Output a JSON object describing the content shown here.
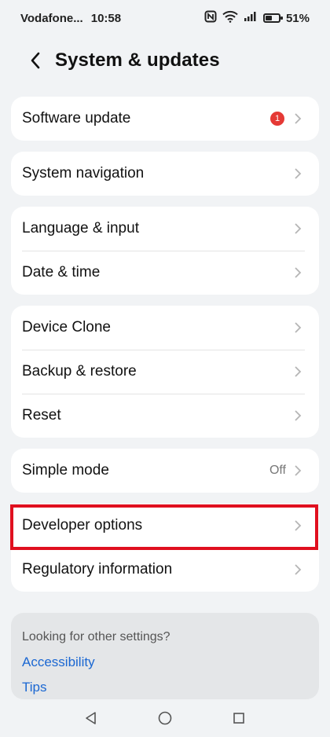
{
  "status_bar": {
    "carrier": "Vodafone...",
    "time": "10:58",
    "battery": "51%",
    "battery_level_pct": 51,
    "icons": [
      "nfc-icon",
      "wifi-icon",
      "signal-icon",
      "battery-icon"
    ]
  },
  "header": {
    "title": "System & updates",
    "back_icon": "chevron-left-icon"
  },
  "sections": [
    {
      "items": [
        {
          "label": "Software update",
          "badge": "1",
          "badge_color": "#e53935"
        }
      ]
    },
    {
      "items": [
        {
          "label": "System navigation"
        }
      ]
    },
    {
      "items": [
        {
          "label": "Language & input"
        },
        {
          "label": "Date & time"
        }
      ]
    },
    {
      "items": [
        {
          "label": "Device Clone"
        },
        {
          "label": "Backup & restore"
        },
        {
          "label": "Reset"
        }
      ]
    },
    {
      "items": [
        {
          "label": "Simple mode",
          "value": "Off"
        }
      ]
    },
    {
      "items": [
        {
          "label": "Developer options",
          "highlighted": true,
          "highlight_color": "#e0101f"
        },
        {
          "label": "Regulatory information"
        }
      ]
    }
  ],
  "suggestions": {
    "title": "Looking for other settings?",
    "links": [
      "Accessibility",
      "Tips"
    ],
    "link_color": "#1a67d2"
  },
  "nav_bar": {
    "buttons": [
      "back-triangle-icon",
      "home-circle-icon",
      "recents-square-icon"
    ]
  }
}
